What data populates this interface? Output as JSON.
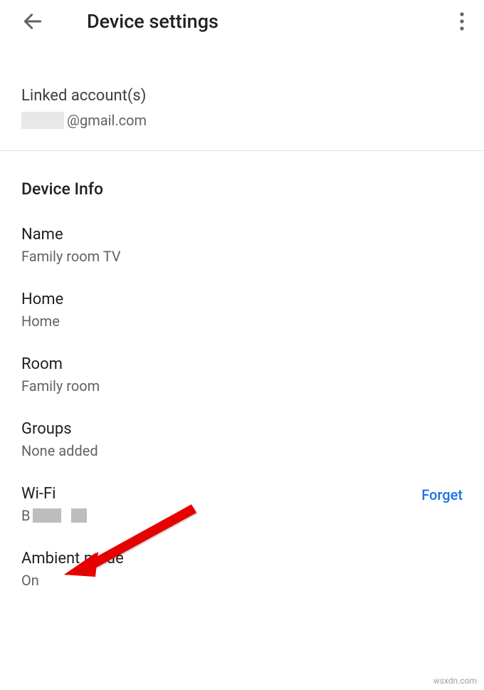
{
  "header": {
    "title": "Device settings"
  },
  "linked_accounts": {
    "title": "Linked account(s)",
    "email_domain": "@gmail.com"
  },
  "device_info": {
    "header": "Device Info",
    "items": {
      "name": {
        "label": "Name",
        "value": "Family room TV"
      },
      "home": {
        "label": "Home",
        "value": "Home"
      },
      "room": {
        "label": "Room",
        "value": "Family room"
      },
      "groups": {
        "label": "Groups",
        "value": "None added"
      },
      "wifi": {
        "label": "Wi-Fi",
        "value_prefix": "B",
        "forget": "Forget"
      },
      "ambient": {
        "label": "Ambient mode",
        "value": "On"
      }
    }
  },
  "watermark": "wsxdn.com"
}
